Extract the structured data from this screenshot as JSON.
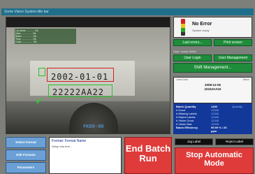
{
  "window": {
    "title": "Some Vision System title bar"
  },
  "camera": {
    "date_text": "2002-01-01",
    "batch_text": "22222AA22",
    "code_text": "FK60-00",
    "overlay_rows": [
      "Lot name ............ Ok",
      "Date ................ Ok",
      "Batch ............... Ok",
      "Time ................ Ok",
      "Code ................ Ok"
    ],
    "ok_icon": "check-icon"
  },
  "status": {
    "title": "No Error",
    "subtitle": "System ready"
  },
  "buttons": {
    "last_errors": "Last errors...",
    "print_screen": "Print screen",
    "user_login": "User Login",
    "user_management": "User Management",
    "shift_management": "Shift Management...",
    "select_format": "Select Format",
    "edit_formats": "Edit Formats",
    "parameters": "Parameters",
    "end_batch": "End Batch Run",
    "job_label": "Jog Label",
    "reject_label": "Reject Label",
    "stop": "Stop Automatic Mode"
  },
  "user": {
    "label": "User: Lowry Smith"
  },
  "batch": {
    "head_left": "Label Data",
    "head_right": "Batch",
    "date": "2008-12-05",
    "code": "22222AA22"
  },
  "stats": [
    {
      "k": "Batch Quantity",
      "v": "1400",
      "u": "Quantity",
      "em": true
    },
    {
      "k": "# Good",
      "v": "12345",
      "u": "",
      "em": false
    },
    {
      "k": "# Missing Labels",
      "v": "12345",
      "u": "",
      "em": false
    },
    {
      "k": "# Reject Labels",
      "v": "12345",
      "u": "",
      "em": false
    },
    {
      "k": "# Vision Good",
      "v": "12345",
      "u": "",
      "em": false
    },
    {
      "k": "# Vision Bad",
      "v": "12345",
      "u": "",
      "em": false
    },
    {
      "k": "Batch Efficiency",
      "v": "99.99 % / 25 ppm",
      "u": "",
      "em": true
    }
  ],
  "format": {
    "title": "Format: Format Name",
    "subtitle": "Setup info text..."
  },
  "colors": {
    "accent_green": "#1e8c3a",
    "stop_red": "#df3b3b",
    "stats_blue": "#12389a",
    "side_btn_blue": "#6aa0d6"
  }
}
